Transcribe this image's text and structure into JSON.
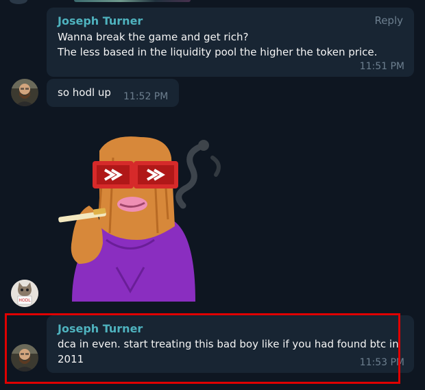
{
  "messages": [
    {
      "sender": "Joseph Turner",
      "lines": [
        "Wanna break the game and get rich?",
        "The less based in the liquidity pool the higher the token price."
      ],
      "time": "11:51 PM",
      "reply_label": "Reply"
    },
    {
      "text": "so hodl up",
      "time": "11:52 PM"
    },
    {
      "sticker": "bearded-character-smoking-sticker"
    },
    {
      "sender": "Joseph Turner",
      "lines": [
        "dca in even. start treating this bad boy like if you had found btc in",
        "2011"
      ],
      "time": "11:53 PM"
    }
  ],
  "sticker": {
    "badge_text": "HODL"
  },
  "colors": {
    "background": "#0e1621",
    "bubble": "#182533",
    "sender": "#4fb3bf",
    "highlight": "#e00000"
  }
}
